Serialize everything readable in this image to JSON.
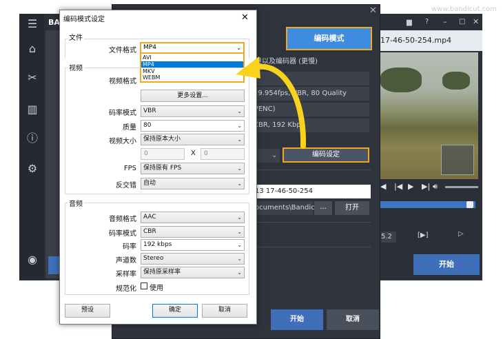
{
  "watermark": "www.bandicut.com",
  "back_app": {
    "logo": "BAN",
    "right_filename": "17-46-50-254.mp4",
    "time_readout": "5.2",
    "frame_step": "[▶]",
    "start_label": "开始",
    "fps_partial": "5",
    "sidebar_icons": [
      "menu-icon",
      "home-icon",
      "cut-icon",
      "segments-icon",
      "info-icon",
      "gear-icon",
      "record-icon"
    ]
  },
  "mid_dialog": {
    "mode_button": "编码模式",
    "description": "量以及编码器 (更慢)",
    "video_info": "29.954fps, VBR, 80 Quality",
    "codec_info": "VENC)",
    "audio_info": "CBR, 192 Kbps",
    "encode_settings_button": "编码设定",
    "filename": "13 17-46-50-254",
    "folder": "ocuments\\Bandicu",
    "browse_button": "...",
    "open_button": "打开",
    "ok_button": "开始",
    "cancel_button": "取消",
    "partial_tab": "S"
  },
  "dialog": {
    "title": "编码模式设定",
    "file_group": {
      "title": "文件",
      "format_label": "文件格式",
      "format_value": "MP4",
      "format_options": [
        "AVI",
        "MP4",
        "MKV",
        "WEBM"
      ],
      "selected_option": "MP4"
    },
    "video_group": {
      "title": "视频",
      "format_label": "视频格式",
      "more_settings_button": "更多设置...",
      "rate_mode_label": "码率模式",
      "rate_mode_value": "VBR",
      "quality_label": "质量",
      "quality_value": "80",
      "size_label": "视频大小",
      "size_value": "保持原本大小",
      "width_value": "0",
      "height_value": "0",
      "size_separator": "X",
      "fps_label": "FPS",
      "fps_value": "保持原有 FPS",
      "deinterlace_label": "反交错",
      "deinterlace_value": "自动"
    },
    "audio_group": {
      "title": "音频",
      "format_label": "音频格式",
      "format_value": "AAC",
      "rate_mode_label": "码率模式",
      "rate_mode_value": "CBR",
      "bitrate_label": "码率",
      "bitrate_value": "192 kbps",
      "channels_label": "声道数",
      "channels_value": "Stereo",
      "samplerate_label": "采样率",
      "samplerate_value": "保持原采样率",
      "normalize_label": "规范化",
      "normalize_checkbox_label": "使用"
    },
    "preset_button": "预设",
    "ok_button": "确定",
    "cancel_button": "取消"
  },
  "colors": {
    "highlight": "#f5a623",
    "accent_blue": "#3e8ce0",
    "selection": "#0078d7",
    "arrow": "#f7d31c"
  }
}
